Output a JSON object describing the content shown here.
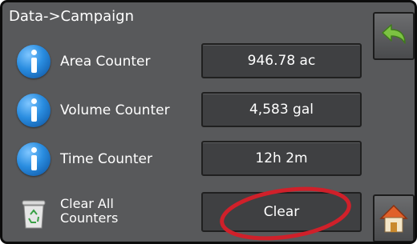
{
  "screen": {
    "breadcrumb": "Data->Campaign"
  },
  "counters": [
    {
      "label": "Area Counter",
      "value": "946.78 ac",
      "icon": "info-icon"
    },
    {
      "label": "Volume Counter",
      "value": "4,583 gal",
      "icon": "info-icon"
    },
    {
      "label": "Time Counter",
      "value": "12h 2m",
      "icon": "info-icon"
    }
  ],
  "clear_all": {
    "label_line1": "Clear All",
    "label_line2": "Counters",
    "button_label": "Clear",
    "icon": "recycle-bin-icon"
  },
  "side_buttons": {
    "back_icon": "back-arrow-icon",
    "home_icon": "home-icon"
  },
  "colors": {
    "background": "#58595b",
    "value_box": "#3f4042",
    "info_icon": "#2a8de0",
    "back_arrow": "#7cc242",
    "home_roof": "#e0612a",
    "annotation": "#d0202a"
  }
}
